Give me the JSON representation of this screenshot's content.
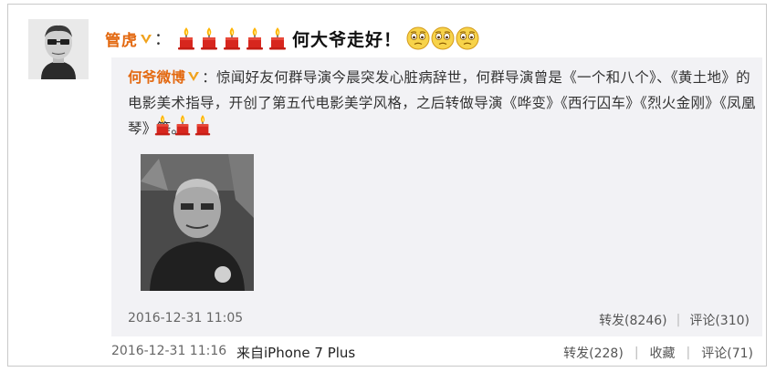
{
  "post": {
    "author": "管虎",
    "colon": "：",
    "text": "何大爷走好！",
    "candle_count": 5,
    "face_count": 3,
    "timestamp": "2016-12-31 11:16",
    "source": "来自iPhone 7 Plus",
    "repost": "转发(228)",
    "favorite": "收藏",
    "comment": "评论(71)"
  },
  "retweet": {
    "author": "何爷微博",
    "colon": "：",
    "text": "惊闻好友何群导演今晨突发心脏病辞世，何群导演曾是《一个和八个》、《黄土地》的电影美术指导，开创了第五代电影美学风格，之后转做导演《哗变》《西行囚车》《烈火金刚》《凤凰琴》等。",
    "candle_count": 3,
    "timestamp": "2016-12-31 11:05",
    "repost": "转发(8246)",
    "comment": "评论(310)"
  },
  "separator": "|",
  "colors": {
    "name": "#e3680f",
    "retweet_bg": "#f2f2f5",
    "border": "#c9c9c9"
  },
  "icons": [
    "avatar-photo",
    "verified-v-icon",
    "candle-icon",
    "worried-face-icon",
    "portrait-photo"
  ]
}
